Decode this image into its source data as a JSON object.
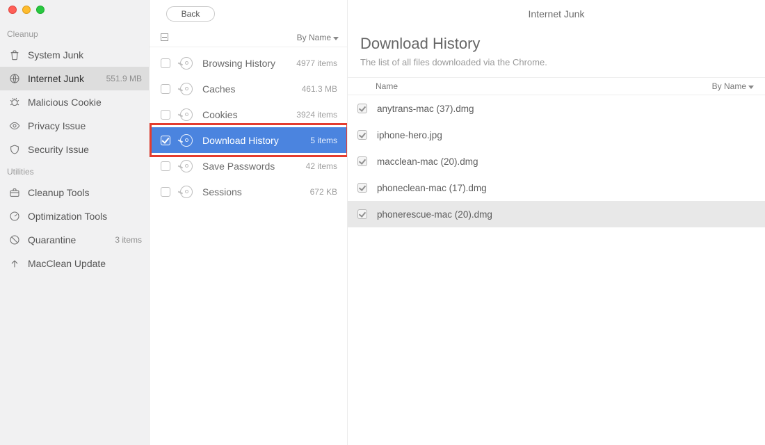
{
  "header": {
    "back_label": "Back",
    "page_title": "Internet Junk"
  },
  "sidebar": {
    "groups": [
      {
        "label": "Cleanup",
        "items": [
          {
            "id": "system-junk",
            "icon": "trash-icon",
            "label": "System Junk",
            "meta": ""
          },
          {
            "id": "internet-junk",
            "icon": "globe-icon",
            "label": "Internet Junk",
            "meta": "551.9 MB",
            "selected": true
          },
          {
            "id": "malicious-cookie",
            "icon": "bug-icon",
            "label": "Malicious Cookie",
            "meta": ""
          },
          {
            "id": "privacy-issue",
            "icon": "eye-icon",
            "label": "Privacy Issue",
            "meta": ""
          },
          {
            "id": "security-issue",
            "icon": "shield-icon",
            "label": "Security Issue",
            "meta": ""
          }
        ]
      },
      {
        "label": "Utilities",
        "items": [
          {
            "id": "cleanup-tools",
            "icon": "toolbox-icon",
            "label": "Cleanup Tools",
            "meta": ""
          },
          {
            "id": "optimization-tools",
            "icon": "gauge-icon",
            "label": "Optimization Tools",
            "meta": ""
          },
          {
            "id": "quarantine",
            "icon": "quarantine-icon",
            "label": "Quarantine",
            "meta": "3 items"
          },
          {
            "id": "macclean-update",
            "icon": "arrow-up-icon",
            "label": "MacClean Update",
            "meta": ""
          }
        ]
      }
    ]
  },
  "middle": {
    "sort_label": "By Name",
    "categories": [
      {
        "id": "browsing-history",
        "label": "Browsing History",
        "meta": "4977 items",
        "checked": false,
        "selected": false,
        "icon": "chrome-icon"
      },
      {
        "id": "caches",
        "label": "Caches",
        "meta": "461.3 MB",
        "checked": false,
        "selected": false,
        "icon": "chrome-icon"
      },
      {
        "id": "cookies",
        "label": "Cookies",
        "meta": "3924 items",
        "checked": false,
        "selected": false,
        "icon": "chrome-icon"
      },
      {
        "id": "download-history",
        "label": "Download History",
        "meta": "5 items",
        "checked": true,
        "selected": true,
        "icon": "chrome-icon"
      },
      {
        "id": "save-passwords",
        "label": "Save Passwords",
        "meta": "42 items",
        "checked": false,
        "selected": false,
        "icon": "chrome-icon"
      },
      {
        "id": "sessions",
        "label": "Sessions",
        "meta": "672 KB",
        "checked": false,
        "selected": false,
        "icon": "chrome-icon"
      }
    ]
  },
  "detail": {
    "heading": "Download History",
    "subtitle": "The list of all files downloaded via the Chrome.",
    "col_name": "Name",
    "sort_label": "By Name",
    "files": [
      {
        "name": "anytrans-mac (37).dmg",
        "checked": true,
        "hover": false
      },
      {
        "name": "iphone-hero.jpg",
        "checked": true,
        "hover": false
      },
      {
        "name": "macclean-mac (20).dmg",
        "checked": true,
        "hover": false
      },
      {
        "name": "phoneclean-mac (17).dmg",
        "checked": true,
        "hover": false
      },
      {
        "name": "phonerescue-mac (20).dmg",
        "checked": true,
        "hover": true
      }
    ]
  }
}
